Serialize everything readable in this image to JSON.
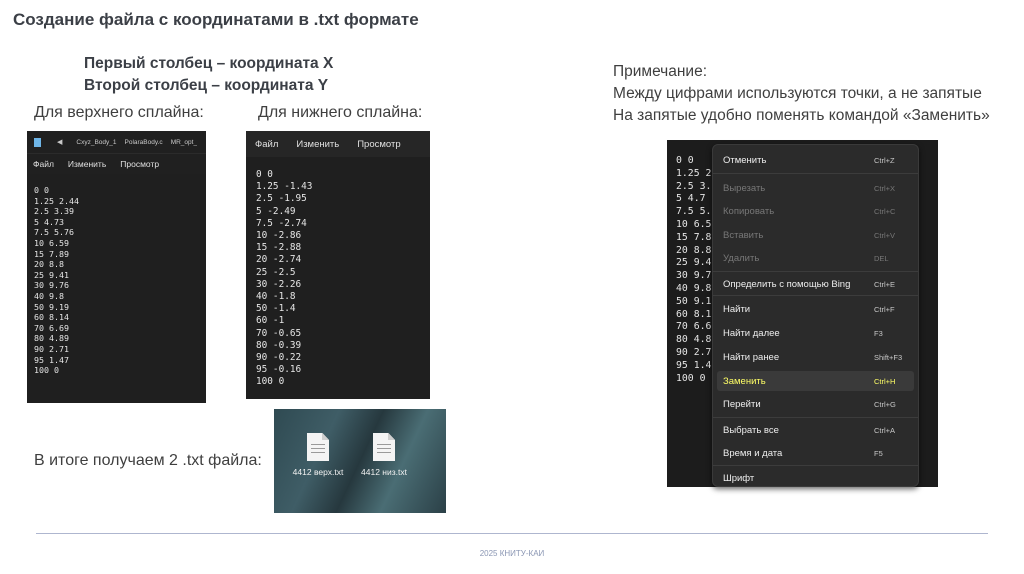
{
  "title": "Создание файла с координатами в .txt формате",
  "subtitle": [
    "Первый столбец – координата X",
    "Второй столбец – координата Y"
  ],
  "label_upper": "Для верхнего сплайна:",
  "label_lower": "Для нижнего сплайна:",
  "note": [
    "Примечание:",
    "Между цифрами используются точки, а не запятые",
    "На запятые удобно поменять командой «Заменить»"
  ],
  "result_label": "В итоге получаем 2 .txt файла:",
  "notepad_upper": {
    "tabs": [
      "Cxyz_Body_1",
      "PolaraBody.c",
      "MR_opt_"
    ],
    "menu": [
      "Файл",
      "Изменить",
      "Просмотр"
    ],
    "text": "0 0\n1.25 2.44\n2.5 3.39\n5 4.73\n7.5 5.76\n10 6.59\n15 7.89\n20 8.8\n25 9.41\n30 9.76\n40 9.8\n50 9.19\n60 8.14\n70 6.69\n80 4.89\n90 2.71\n95 1.47\n100 0"
  },
  "notepad_lower": {
    "menu": [
      "Файл",
      "Изменить",
      "Просмотр"
    ],
    "text": "0 0\n1.25 -1.43\n2.5 -1.95\n5 -2.49\n7.5 -2.74\n10 -2.86\n15 -2.88\n20 -2.74\n25 -2.5\n30 -2.26\n40 -1.8\n50 -1.4\n60 -1\n70 -0.65\n80 -0.39\n90 -0.22\n95 -0.16\n100 0"
  },
  "files": [
    "4412 верх.txt",
    "4412 низ.txt"
  ],
  "context_bg_text": "0 0\n1.25 2\n2.5 3.\n5 4.7\n7.5 5.\n10 6.5\n15 7.8\n20 8.8\n25 9.4\n30 9.7\n40 9.8\n50 9.1\n60 8.1\n70 6.6\n80 4.8\n90 2.7\n95 1.4\n100 0",
  "context_menu": [
    {
      "label": "Отменить",
      "shortcut": "Ctrl+Z",
      "state": "normal"
    },
    {
      "label": "Вырезать",
      "shortcut": "Ctrl+X",
      "state": "disabled"
    },
    {
      "label": "Копировать",
      "shortcut": "Ctrl+C",
      "state": "disabled"
    },
    {
      "label": "Вставить",
      "shortcut": "Ctrl+V",
      "state": "disabled"
    },
    {
      "label": "Удалить",
      "shortcut": "DEL",
      "state": "disabled"
    },
    {
      "label": "Определить с помощью Bing",
      "shortcut": "Ctrl+E",
      "state": "normal"
    },
    {
      "label": "Найти",
      "shortcut": "Ctrl+F",
      "state": "normal"
    },
    {
      "label": "Найти далее",
      "shortcut": "F3",
      "state": "normal"
    },
    {
      "label": "Найти ранее",
      "shortcut": "Shift+F3",
      "state": "normal"
    },
    {
      "label": "Заменить",
      "shortcut": "Ctrl+H",
      "state": "highlighted"
    },
    {
      "label": "Перейти",
      "shortcut": "Ctrl+G",
      "state": "normal"
    },
    {
      "label": "Выбрать все",
      "shortcut": "Ctrl+A",
      "state": "normal"
    },
    {
      "label": "Время и дата",
      "shortcut": "F5",
      "state": "normal"
    },
    {
      "label": "Шрифт",
      "shortcut": "",
      "state": "normal"
    }
  ],
  "highlight_color": "#ffff66",
  "footer": "2025 КНИТУ-КАИ"
}
